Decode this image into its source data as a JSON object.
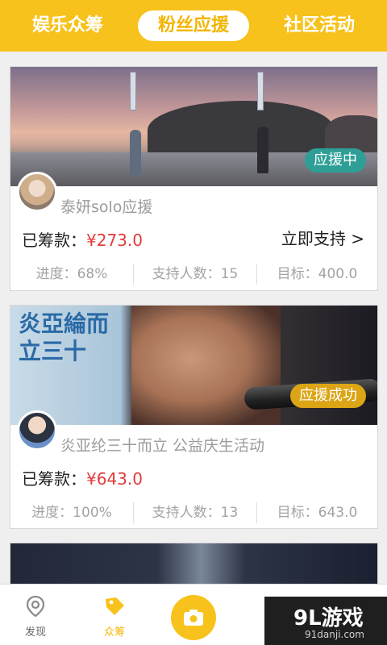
{
  "tabs": {
    "ent_crowdfunding": "娱乐众筹",
    "fan_support": "粉丝应援",
    "community": "社区活动"
  },
  "cards": [
    {
      "title": "泰妍solo应援",
      "status": "应援中",
      "raised_label": "已筹款：",
      "raised_value": "¥273.0",
      "support_button": "立即支持 >",
      "progress": "进度：68%",
      "supporters": "支持人数：15",
      "target": "目标：400.0"
    },
    {
      "title": "炎亚纶三十而立 公益庆生活动",
      "status": "应援成功",
      "raised_label": "已筹款：",
      "raised_value": "¥643.0",
      "poster_text": "炎亞綸而立三十",
      "progress": "进度：100%",
      "supporters": "支持人数：13",
      "target": "目标：643.0"
    }
  ],
  "nav": {
    "discover": "发现",
    "crowdfund": "众筹"
  },
  "watermark": {
    "brand": "9L游戏",
    "url": "91danji.com"
  },
  "colors": {
    "accent": "#f7c21b",
    "price": "#e23b3b",
    "live_badge": "#2e9f96",
    "done_badge": "#dca516"
  }
}
